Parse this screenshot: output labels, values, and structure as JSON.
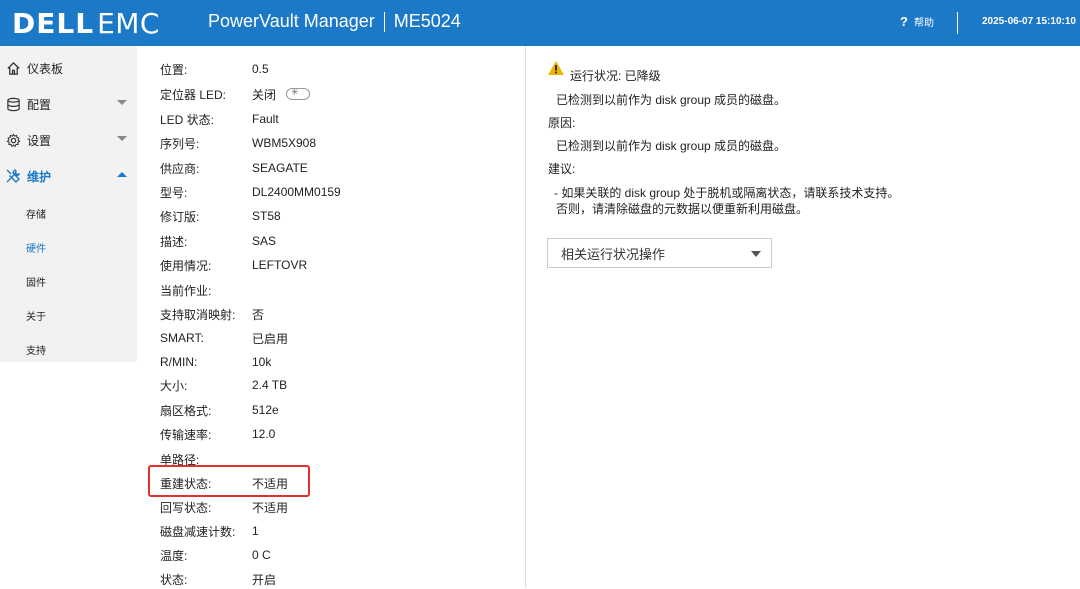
{
  "header": {
    "logo_dell": "DELL",
    "logo_emc": "EMC",
    "product": "PowerVault Manager",
    "system": "ME5024",
    "help_icon": "?",
    "help_label": "帮助",
    "datetime": "2025-06-07 15:10:10",
    "background": "#1c79c7"
  },
  "sidebar": {
    "items": [
      {
        "label": "仪表板",
        "icon": "home-icon"
      },
      {
        "label": "配置",
        "icon": "database-icon"
      },
      {
        "label": "设置",
        "icon": "gear-icon"
      },
      {
        "label": "维护",
        "icon": "tools-icon"
      }
    ],
    "subitems": [
      {
        "label": "存储"
      },
      {
        "label": "硬件"
      },
      {
        "label": "固件"
      },
      {
        "label": "关于"
      },
      {
        "label": "支持"
      }
    ],
    "active_item": "维护",
    "active_subitem": "硬件"
  },
  "details": [
    {
      "label": "位置:",
      "value": "0.5"
    },
    {
      "label": "定位器 LED:",
      "value": "关闭"
    },
    {
      "label": "LED 状态:",
      "value": "Fault"
    },
    {
      "label": "序列号:",
      "value": "WBM5X908"
    },
    {
      "label": "供应商:",
      "value": "SEAGATE"
    },
    {
      "label": "型号:",
      "value": "DL2400MM0159"
    },
    {
      "label": "修订版:",
      "value": "ST58"
    },
    {
      "label": "描述:",
      "value": "SAS"
    },
    {
      "label": "使用情况:",
      "value": "LEFTOVR"
    },
    {
      "label": "当前作业:",
      "value": ""
    },
    {
      "label": "支持取消映射:",
      "value": "否"
    },
    {
      "label": "SMART:",
      "value": "已启用"
    },
    {
      "label": "R/MIN:",
      "value": "10k"
    },
    {
      "label": "大小:",
      "value": "2.4 TB"
    },
    {
      "label": "扇区格式:",
      "value": "512e"
    },
    {
      "label": "传输速率:",
      "value": "12.0"
    },
    {
      "label": "单路径:",
      "value": ""
    },
    {
      "label": "重建状态:",
      "value": "不适用"
    },
    {
      "label": "回写状态:",
      "value": "不适用"
    },
    {
      "label": "磁盘减速计数:",
      "value": "1"
    },
    {
      "label": "温度:",
      "value": "0 C"
    },
    {
      "label": "状态:",
      "value": "开启"
    }
  ],
  "health": {
    "status_label": "运行状况: 已降级",
    "status_text": "已检测到以前作为 disk group 成员的磁盘。",
    "reason_label": "原因:",
    "reason_text": "已检测到以前作为 disk group 成员的磁盘。",
    "recommend_label": "建议:",
    "recommend_line1": "- 如果关联的 disk group 处于脱机或隔离状态，请联系技术支持。",
    "recommend_line2": "否则，请清除磁盘的元数据以便重新利用磁盘。",
    "warning_color": "#f0b400"
  },
  "actions_dropdown": {
    "label": "相关运行状况操作"
  }
}
